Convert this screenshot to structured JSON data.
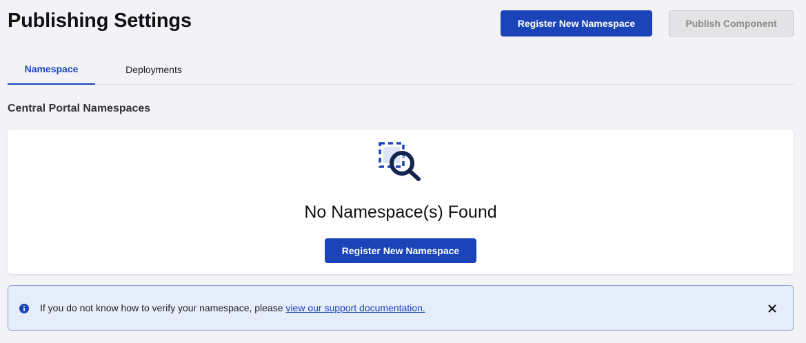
{
  "header": {
    "title": "Publishing Settings",
    "register_label": "Register New Namespace",
    "publish_label": "Publish Component"
  },
  "tabs": [
    {
      "label": "Namespace",
      "active": true
    },
    {
      "label": "Deployments",
      "active": false
    }
  ],
  "section": {
    "title": "Central Portal Namespaces"
  },
  "empty_state": {
    "icon": "search-dashed-square-icon",
    "title": "No Namespace(s) Found",
    "button_label": "Register New Namespace"
  },
  "alert": {
    "icon": "info-icon",
    "text": "If you do not know how to verify your namespace, please ",
    "link_text": "view our support documentation.",
    "close_icon": "close-icon"
  },
  "colors": {
    "primary": "#1a44b8",
    "background": "#f2f2f7",
    "alert_background": "#e5ecfa",
    "icon_navy": "#13254f"
  }
}
